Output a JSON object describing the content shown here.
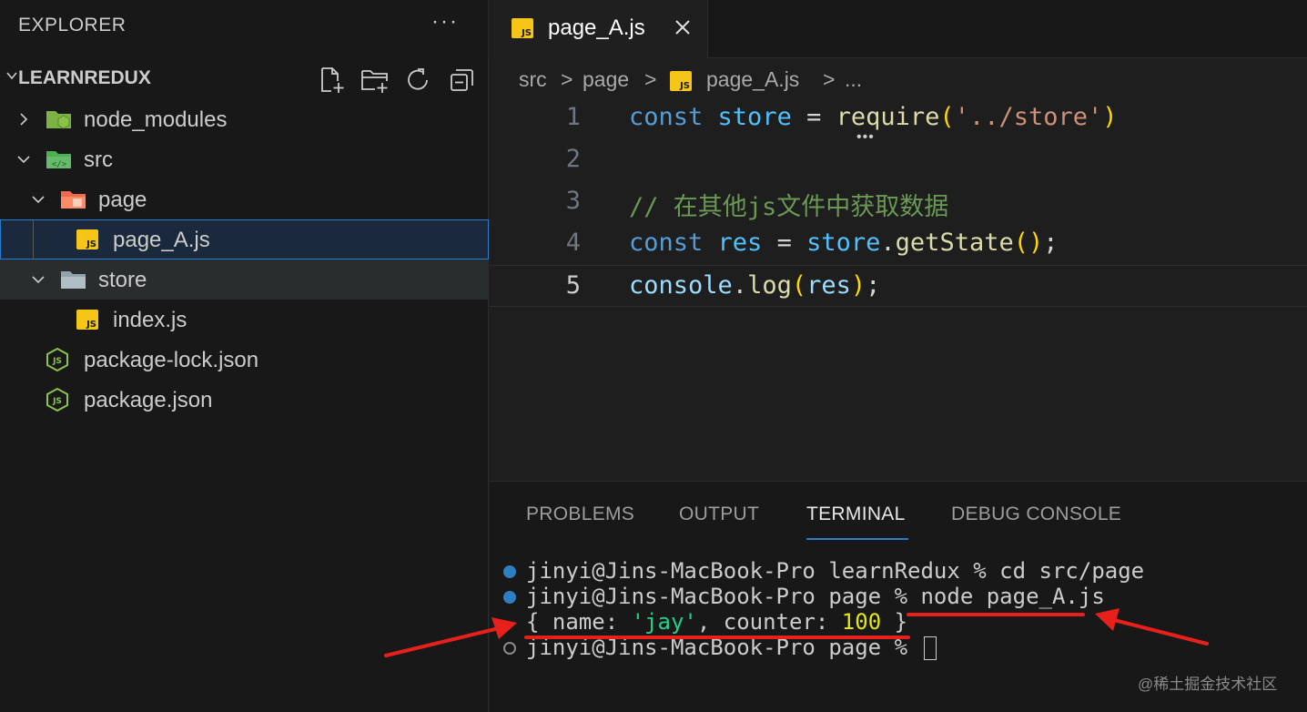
{
  "sidebar": {
    "header": "EXPLORER",
    "more": "···",
    "project": "LEARNREDUX",
    "items": [
      {
        "label": "node_modules"
      },
      {
        "label": "src"
      },
      {
        "label": "page"
      },
      {
        "label": "page_A.js"
      },
      {
        "label": "store"
      },
      {
        "label": "index.js"
      },
      {
        "label": "package-lock.json"
      },
      {
        "label": "package.json"
      }
    ]
  },
  "editor": {
    "tab": {
      "label": "page_A.js"
    },
    "breadcrumb": {
      "parts": [
        "src",
        "page",
        "page_A.js",
        "..."
      ],
      "sep": ">"
    },
    "lines": [
      {
        "num": "1",
        "t1": "const",
        "t2": "store",
        "t3": "=",
        "t4": "require",
        "t5": "(",
        "t6": "'../store'",
        "t7": ")"
      },
      {
        "num": "2"
      },
      {
        "num": "3",
        "comment": "// 在其他js文件中获取数据"
      },
      {
        "num": "4",
        "t1": "const",
        "t2": "res",
        "t3": "=",
        "t4": "store",
        "t5": ".",
        "t6": "getState",
        "t7": "()",
        "t8": ";"
      },
      {
        "num": "5",
        "t1": "console",
        "t2": ".",
        "t3": "log",
        "t4": "(",
        "t5": "res",
        "t6": ")",
        "t7": ";"
      }
    ]
  },
  "panel": {
    "tabs": [
      "PROBLEMS",
      "OUTPUT",
      "TERMINAL",
      "DEBUG CONSOLE"
    ],
    "terminal": {
      "line1": "jinyi@Jins-MacBook-Pro learnRedux % cd src/page",
      "line2": "jinyi@Jins-MacBook-Pro page % node page_A.js",
      "line3a": "{ name: ",
      "line3b": "'jay'",
      "line3c": ", counter: ",
      "line3d": "100",
      "line3e": " }",
      "line4": "jinyi@Jins-MacBook-Pro page % "
    }
  },
  "watermark": "@稀土掘金技术社区",
  "colors": {
    "annotation": "#e8201c",
    "selection": "#2b7bcf",
    "js_badge": "#f5c518"
  }
}
